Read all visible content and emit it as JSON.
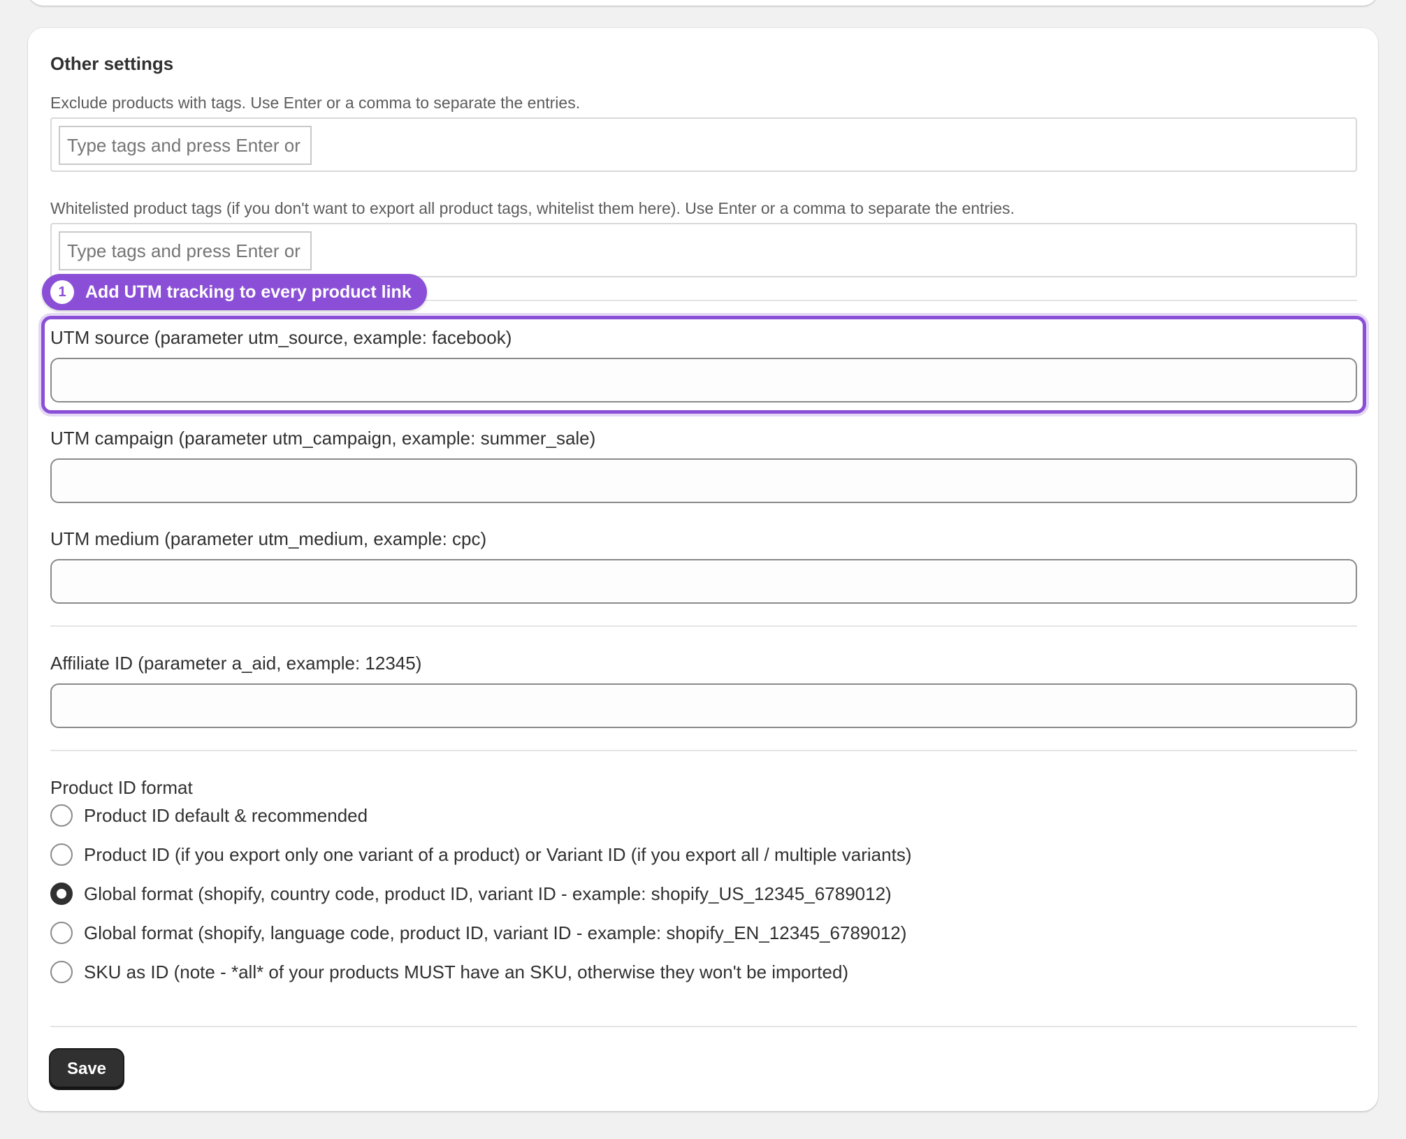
{
  "other_settings": {
    "title": "Other settings",
    "exclude_tags": {
      "help": "Exclude products with tags. Use Enter or a comma to separate the entries.",
      "placeholder": "Type tags and press Enter or comma"
    },
    "whitelist_tags": {
      "help": "Whitelisted product tags (if you don't want to export all product tags, whitelist them here). Use Enter or a comma to separate the entries.",
      "placeholder": "Type tags and press Enter or comma"
    }
  },
  "callout": {
    "number": "1",
    "text": "Add UTM tracking to every product link",
    "color": "#8a4fd6"
  },
  "utm": {
    "source": {
      "label": "UTM source (parameter utm_source, example: facebook)",
      "value": ""
    },
    "campaign": {
      "label": "UTM campaign (parameter utm_campaign, example: summer_sale)",
      "value": ""
    },
    "medium": {
      "label": "UTM medium (parameter utm_medium, example: cpc)",
      "value": ""
    }
  },
  "affiliate": {
    "label": "Affiliate ID (parameter a_aid, example: 12345)",
    "value": ""
  },
  "product_id_format": {
    "label": "Product ID format",
    "options": [
      {
        "label": "Product ID default & recommended",
        "checked": false
      },
      {
        "label": "Product ID (if you export only one variant of a product) or Variant ID (if you export all / multiple variants)",
        "checked": false
      },
      {
        "label": "Global format (shopify, country code, product ID, variant ID - example: shopify_US_12345_6789012)",
        "checked": true
      },
      {
        "label": "Global format (shopify, language code, product ID, variant ID - example: shopify_EN_12345_6789012)",
        "checked": false
      },
      {
        "label": "SKU as ID (note - *all* of your products MUST have an SKU, otherwise they won't be imported)",
        "checked": false
      }
    ]
  },
  "save_label": "Save"
}
